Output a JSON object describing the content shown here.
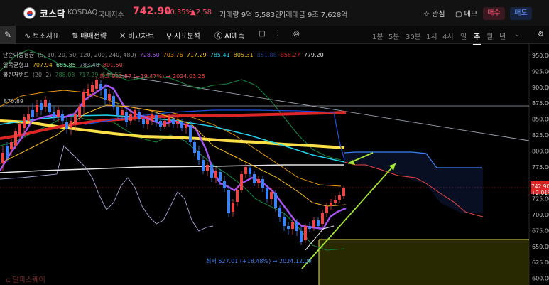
{
  "header": {
    "name": "코스닥",
    "code": "KOSDAQ",
    "category": "국내지수",
    "price": "742.90",
    "change_pct": "+0.35%",
    "change": "▲2.58",
    "volume": "거래량 9억 5,583만",
    "amount": "거래대금 9조 7,628억",
    "favorite": "관심",
    "memo": "메모",
    "buy": "매수",
    "sell": "매도"
  },
  "toolbar": {
    "items": [
      "보조지표",
      "매매전략",
      "비교차트",
      "지표분석",
      "AI예측"
    ],
    "periods": [
      "1분",
      "5분",
      "30분",
      "1시",
      "4시",
      "일",
      "주",
      "월",
      "년"
    ],
    "active_period": "주"
  },
  "legend": {
    "sma_label": "단순이동평균",
    "sma_params": "(5, 10, 20, 50, 120, 200, 240, 480)",
    "sma_values": [
      {
        "value": "728.50",
        "color": "#a855f7"
      },
      {
        "value": "703.76",
        "color": "#f59e0b"
      },
      {
        "value": "717.29",
        "color": "#facc15"
      },
      {
        "value": "785.41",
        "color": "#22d3ee"
      },
      {
        "value": "805.31",
        "color": "#eab308"
      },
      {
        "value": "851.88",
        "color": "#1e3a8a"
      },
      {
        "value": "858.27",
        "color": "#dc2626"
      },
      {
        "value": "779.20",
        "color": "#e5e7eb"
      }
    ],
    "ichimoku_label": "일목균형표",
    "ichimoku_values": [
      {
        "value": "707.94",
        "color": "#eab308"
      },
      {
        "value": "685.85",
        "color": "#86efac"
      },
      {
        "value": "783.48",
        "color": "#94a3b8"
      },
      {
        "value": "801.50",
        "color": "#ef4444"
      }
    ],
    "bollinger_label": "볼린저밴드",
    "bollinger_params": "(20, 2)",
    "bollinger_values": [
      {
        "value": "788.03",
        "color": "#15803d"
      },
      {
        "value": "717.29",
        "color": "#15803d"
      },
      {
        "value": "646.55",
        "color": "#15803d"
      }
    ]
  },
  "annotations": {
    "level_label": "870.89",
    "high_label": "최고 922.57 (−19.47%) → 2024.03.25",
    "low_label": "최저 627.01 (+18.48%) → 2024.12.09"
  },
  "yaxis": {
    "ticks": [
      "950.00",
      "925.00",
      "900.00",
      "875.00",
      "850.00",
      "825.00",
      "800.00",
      "775.00",
      "750.00",
      "725.00",
      "700.00",
      "675.00",
      "650.00",
      "625.00",
      "600.00"
    ],
    "last_price": "742.90",
    "last_pct": "+2.01%"
  },
  "colors": {
    "up": "#ef4444",
    "down": "#3b82f6",
    "accent": "#ff4d6a"
  },
  "watermark": "알파스퀘어"
}
